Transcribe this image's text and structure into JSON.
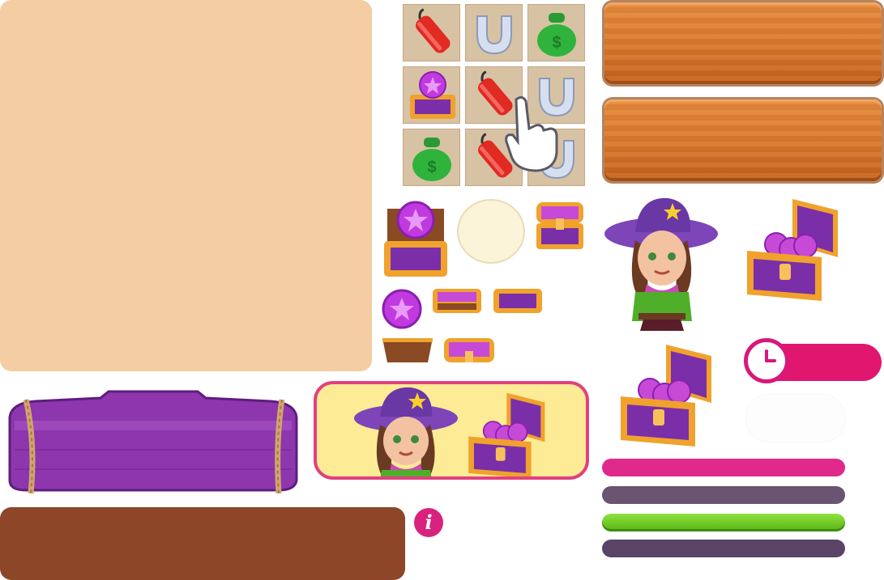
{
  "palette": {
    "peach_panel": "#f5cda3",
    "brown_panel": "#8e4628",
    "wood_orange": "#d9772b",
    "purple_sign": "#9b3fb8",
    "pink_bar": "#df2a8c",
    "mauve_bar": "#6a5471",
    "green_bar": "#6cc61f",
    "dark_bar": "#5a4466",
    "timer_pink": "#e1166e",
    "banner_yellow": "#fdeb96",
    "banner_border": "#e2407e"
  },
  "match_board": {
    "rows": [
      [
        "dynamite-icon",
        "horseshoe-icon",
        "money-bag-icon"
      ],
      [
        "treasure-chest-coin-icon",
        "dynamite-icon",
        "horseshoe-icon"
      ],
      [
        "money-bag-icon",
        "dynamite-icon",
        "horseshoe-icon"
      ]
    ],
    "pointer": "hand-pointer-icon"
  },
  "assets": {
    "character": "cowgirl-character",
    "chest": "treasure-chest-open-icon",
    "coin": "star-coin-icon",
    "timer": "clock-icon"
  },
  "info_button": {
    "label": "i"
  }
}
